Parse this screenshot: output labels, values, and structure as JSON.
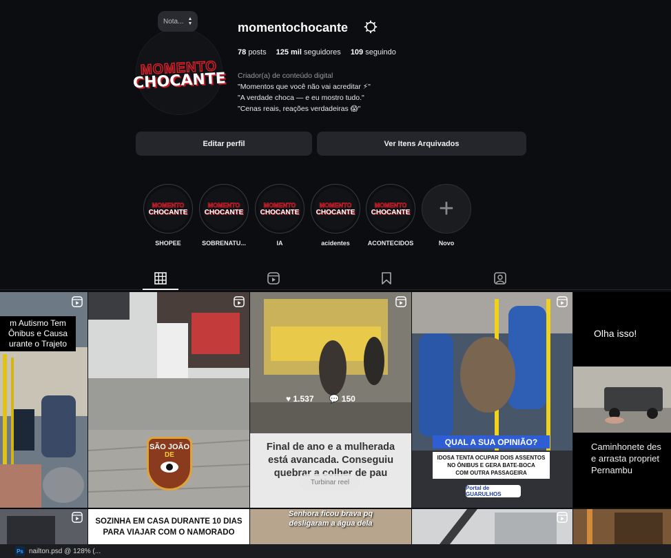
{
  "profile": {
    "username": "momentochocante",
    "avatar_logo_top": "MOMENTO",
    "avatar_logo_bottom": "CHOCANTE",
    "note_label": "Nota...",
    "stats": {
      "posts_count": "78",
      "posts_label": "posts",
      "followers_count": "125 mil",
      "followers_label": "seguidores",
      "following_count": "109",
      "following_label": "seguindo"
    },
    "category": "Criador(a) de conteúdo digital",
    "bio_lines": [
      "\"Momentos que você não vai acreditar ⚡\"",
      "\"A verdade choca — e eu mostro tudo.\"",
      "\"Cenas reais, reações verdadeiras 😱\""
    ]
  },
  "buttons": {
    "edit_profile": "Editar perfil",
    "archived": "Ver Itens Arquivados"
  },
  "highlights": [
    {
      "label": "SHOPEE",
      "logo_top": "MOMENTO",
      "logo_bottom": "CHOCANTE"
    },
    {
      "label": "SOBRENATU...",
      "logo_top": "MOMENTO",
      "logo_bottom": "CHOCANTE"
    },
    {
      "label": "IA",
      "logo_top": "MOMENTO",
      "logo_bottom": "CHOCANTE"
    },
    {
      "label": "acidentes",
      "logo_top": "MOMENTO",
      "logo_bottom": "CHOCANTE"
    },
    {
      "label": "ACONTECIDOS",
      "logo_top": "MOMENTO",
      "logo_bottom": "CHOCANTE"
    },
    {
      "label": "Novo"
    }
  ],
  "tabs": [
    {
      "icon": "grid-icon",
      "active": true
    },
    {
      "icon": "reels-icon",
      "active": false
    },
    {
      "icon": "bookmark-icon",
      "active": false
    },
    {
      "icon": "tagged-icon",
      "active": false
    }
  ],
  "posts": [
    {
      "caption": "m Autismo Tem\nÔnibus e Causa\nurante o Trajeto"
    },
    {
      "badge_line1": "SÃO JOÃO",
      "badge_line2": "DE"
    },
    {
      "likes": "1.537",
      "comments": "150",
      "caption": "Final de ano e a mulherada\nestá avancada. Conseguiu\nquebrar a colher de pau",
      "boost_label": "Turbinar reel"
    },
    {
      "headline": "QUAL A SUA OPINIÃO?",
      "subtext": "IDOSA TENTA OCUPAR DOIS ASSENTOS\nNO ÔNIBUS E GERA BATE-BOCA\nCOM OUTRA PASSAGEIRA",
      "brand": "Portal de GUARULHOS"
    },
    {
      "top_text": "Olha isso!",
      "bottom_text": "Caminhonete des\ne arrasta propriet\nPernambu"
    },
    {},
    {
      "caption": "SOZINHA EM CASA DURANTE 10 DIAS\nPARA VIAJAR COM O NAMORADO"
    },
    {
      "caption": "Senhora ficou brava pq\ndesligaram a água dela"
    },
    {},
    {}
  ],
  "taskbar": {
    "app_icon": "Ps",
    "window_title": "nailton.psd @ 128% (..."
  },
  "colors": {
    "background": "#0c0d10",
    "button_bg": "#25262b",
    "brand_red": "#d51f2a",
    "opinion_blue": "#2f5dd3"
  }
}
